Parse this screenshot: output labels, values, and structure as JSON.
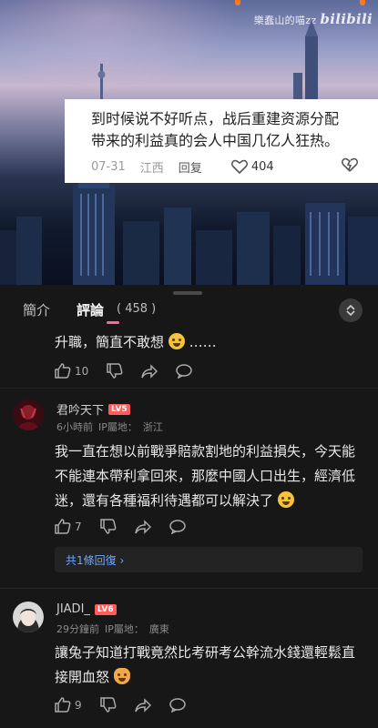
{
  "video": {
    "watermark_user": "樂蠢山的喵zz",
    "watermark_brand": "bilibili",
    "subtitle_card": {
      "lines": [
        "到时候说不好听点，战后重建资源分配",
        "带来的利益真的会人中国几亿人狂热。"
      ],
      "date": "07-31",
      "location": "江西",
      "reply_label": "回复",
      "likes": "404"
    }
  },
  "tabs": {
    "intro": "簡介",
    "comments": "評論",
    "comment_count": "458"
  },
  "comments": [
    {
      "text_before_emoji": "升職，簡直不敢想",
      "text_after_emoji": "……",
      "likes": "10"
    },
    {
      "username": "君吟天下",
      "level": "LV5",
      "time": "6小時前",
      "ip_label": "IP屬地：",
      "location": "浙江",
      "text": "我一直在想以前戰爭賠款割地的利益損失，今天能不能連本帶利拿回來，那麼中國人口出生，經濟低迷，還有各種福利待遇都可以解決了",
      "likes": "7",
      "replies_link": "共1條回復 ›"
    },
    {
      "username": "JIADI_",
      "level": "LV6",
      "time": "29分鐘前",
      "ip_label": "IP屬地：",
      "location": "廣東",
      "text": "讓兔子知道打戰竟然比考研考公幹流水錢還輕鬆直接開血怒",
      "likes": "9"
    }
  ],
  "colors": {
    "accent": "#ff6699",
    "level_badge": "#ff5c5c",
    "link": "#6fa8ff"
  }
}
